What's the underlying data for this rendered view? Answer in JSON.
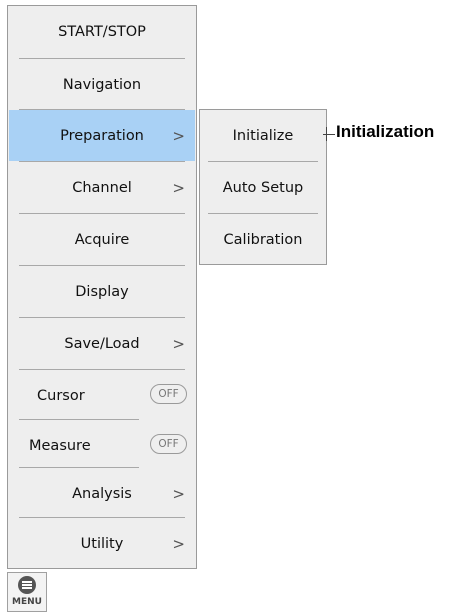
{
  "main_menu": {
    "items": [
      {
        "label": "START/STOP"
      },
      {
        "label": "Navigation"
      },
      {
        "label": "Preparation",
        "arrow": ">"
      },
      {
        "label": "Channel",
        "arrow": ">"
      },
      {
        "label": "Acquire"
      },
      {
        "label": "Display"
      },
      {
        "label": "Save/Load",
        "arrow": ">"
      },
      {
        "label": "Cursor",
        "toggle": "OFF"
      },
      {
        "label": "Measure",
        "toggle": "OFF"
      },
      {
        "label": "Analysis",
        "arrow": ">"
      },
      {
        "label": "Utility",
        "arrow": ">"
      }
    ]
  },
  "submenu": {
    "items": [
      {
        "label": "Initialize"
      },
      {
        "label": "Auto Setup"
      },
      {
        "label": "Calibration"
      }
    ]
  },
  "callout": {
    "text": "Initialization"
  },
  "menu_button": {
    "caption": "MENU",
    "icon": "menu-disc-icon"
  },
  "colors": {
    "panel_bg": "#eeeeee",
    "active_bg": "#a9d1f5",
    "border": "#9a9a9a"
  }
}
